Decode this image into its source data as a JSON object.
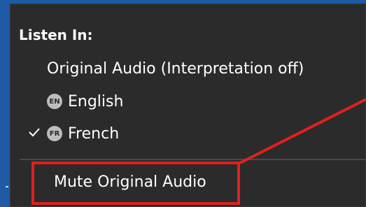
{
  "menu": {
    "header": "Listen In:",
    "items": [
      {
        "label": "Original Audio (Interpretation off)",
        "badge": "",
        "checked": false
      },
      {
        "label": "English",
        "badge": "EN",
        "checked": false
      },
      {
        "label": "French",
        "badge": "FR",
        "checked": true
      }
    ],
    "mute_label": "Mute Original Audio"
  },
  "annotation": {
    "color": "#e02020"
  }
}
